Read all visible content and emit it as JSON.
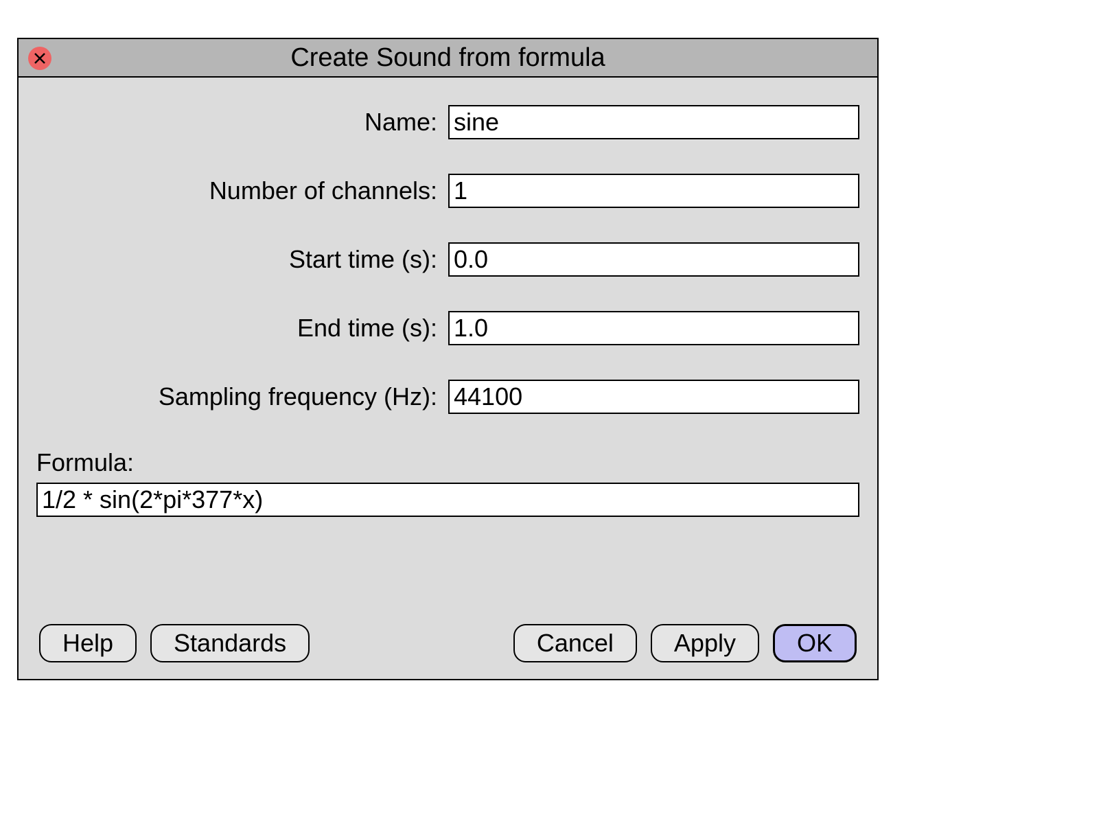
{
  "dialog": {
    "title": "Create Sound from formula"
  },
  "fields": {
    "name": {
      "label": "Name:",
      "value": "sine"
    },
    "channels": {
      "label": "Number of channels:",
      "value": "1"
    },
    "start_time": {
      "label": "Start time (s):",
      "value": "0.0"
    },
    "end_time": {
      "label": "End time (s):",
      "value": "1.0"
    },
    "sampling_freq": {
      "label": "Sampling frequency (Hz):",
      "value": "44100"
    },
    "formula": {
      "label": "Formula:",
      "value": "1/2 * sin(2*pi*377*x)"
    }
  },
  "buttons": {
    "help": "Help",
    "standards": "Standards",
    "cancel": "Cancel",
    "apply": "Apply",
    "ok": "OK"
  }
}
